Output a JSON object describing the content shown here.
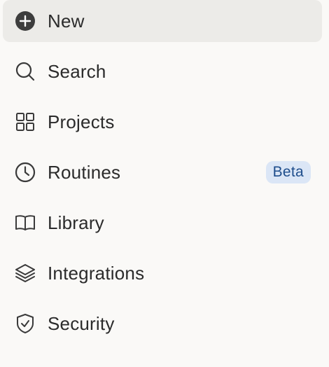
{
  "sidebar": {
    "items": [
      {
        "label": "New",
        "icon": "plus-circle-icon",
        "active": true
      },
      {
        "label": "Search",
        "icon": "search-icon"
      },
      {
        "label": "Projects",
        "icon": "grid-icon"
      },
      {
        "label": "Routines",
        "icon": "clock-icon",
        "badge": "Beta"
      },
      {
        "label": "Library",
        "icon": "book-icon"
      },
      {
        "label": "Integrations",
        "icon": "layers-icon"
      },
      {
        "label": "Security",
        "icon": "shield-check-icon"
      }
    ]
  },
  "colors": {
    "background": "#faf9f7",
    "active_item_bg": "#ecebe8",
    "text": "#2b2b2b",
    "icon": "#3a3a3a",
    "badge_bg": "#dbe6f6",
    "badge_text": "#1f4e8c"
  }
}
